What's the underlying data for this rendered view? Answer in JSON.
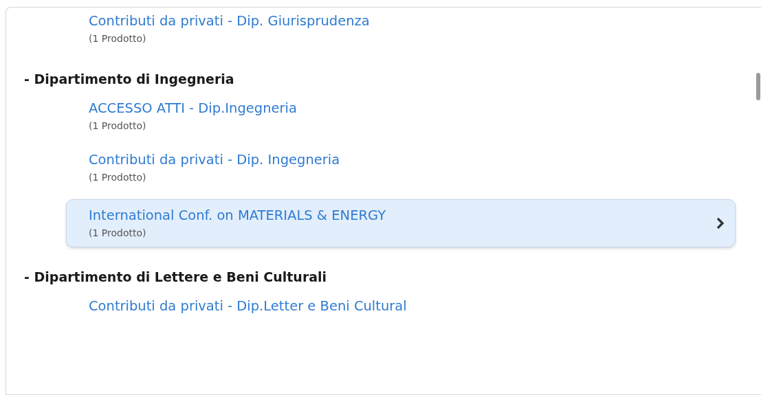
{
  "groups": [
    {
      "items": [
        {
          "title": "Contributi da privati - Dip. Giurisprudenza",
          "count": "(1 Prodotto)",
          "selected": false
        }
      ]
    },
    {
      "heading": "- Dipartimento di Ingegneria",
      "items": [
        {
          "title": "ACCESSO ATTI - Dip.Ingegneria",
          "count": "(1 Prodotto)",
          "selected": false
        },
        {
          "title": "Contributi da privati - Dip. Ingegneria",
          "count": "(1 Prodotto)",
          "selected": false
        },
        {
          "title": "International Conf. on MATERIALS & ENERGY",
          "count": "(1 Prodotto)",
          "selected": true
        }
      ]
    },
    {
      "heading": "- Dipartimento di Lettere e Beni Culturali",
      "items": [
        {
          "title": "Contributi da privati - Dip.Letter e Beni Cultural",
          "selected": false
        }
      ]
    }
  ]
}
